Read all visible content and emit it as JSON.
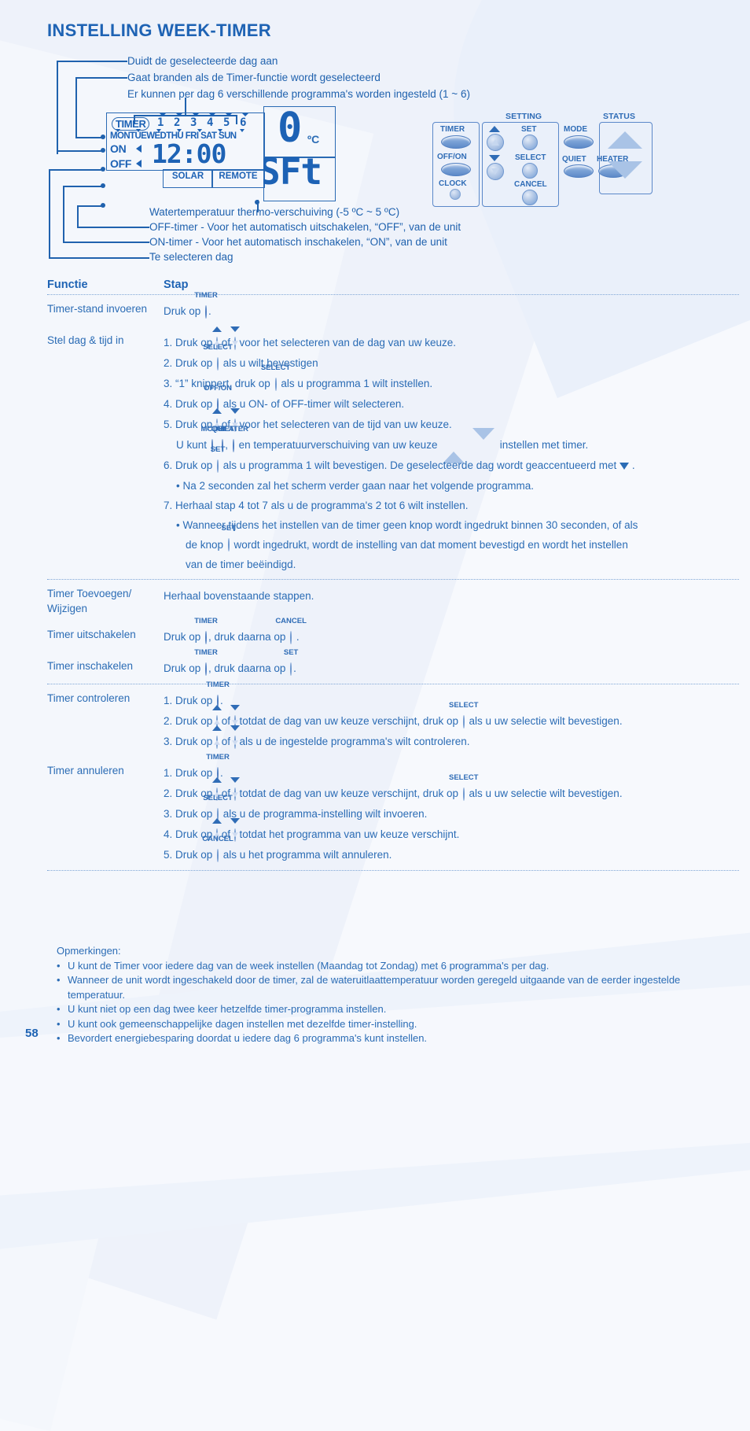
{
  "title": "INSTELLING WEEK-TIMER",
  "page_number": "58",
  "callouts_top": [
    "Duidt de geselecteerde dag aan",
    "Gaat branden als de Timer-functie wordt geselecteerd",
    "Er kunnen per dag 6 verschillende programma's worden ingesteld (1 ~ 6)"
  ],
  "callouts_bottom": [
    "Watertemperatuur thermo-verschuiving (-5 ºC ~ 5 ºC)",
    "OFF-timer - Voor het automatisch uitschakelen, “OFF”, van de unit",
    "ON-timer - Voor het automatisch inschakelen, “ON”, van de unit",
    "Te selecteren dag"
  ],
  "lcd": {
    "timer_label": "TIMER",
    "program_numbers": [
      "1",
      "2",
      "3",
      "4",
      "5",
      "6"
    ],
    "days": [
      "MON",
      "TUE",
      "WED",
      "THU",
      "FRI",
      "SAT",
      "SUN"
    ],
    "on_label": "ON",
    "off_label": "OFF",
    "clock_value": "12:00",
    "solar_label": "SOLAR",
    "remote_label": "REMOTE",
    "temp_value": "0",
    "temp_unit": "ºC",
    "shift_value": "SFt"
  },
  "panel": {
    "setting_group_label": "SETTING",
    "status_group_label": "STATUS",
    "buttons": {
      "timer": "TIMER",
      "off_on": "OFF/ON",
      "clock": "CLOCK",
      "set": "SET",
      "select": "SELECT",
      "cancel": "CANCEL",
      "mode": "MODE",
      "quiet": "QUIET",
      "heater": "HEATER"
    }
  },
  "table": {
    "header": {
      "col1": "Functie",
      "col2": "Stap"
    },
    "rows": [
      {
        "function": "Timer-stand invoeren",
        "lines": [
          {
            "indent": 0,
            "parts": [
              {
                "t": "text",
                "v": "Druk op "
              },
              {
                "t": "btn",
                "style": "oval",
                "cap": "TIMER"
              },
              {
                "t": "text",
                "v": "."
              }
            ]
          }
        ]
      },
      {
        "function": "Stel dag & tijd in",
        "lines": [
          {
            "indent": 0,
            "parts": [
              {
                "t": "text",
                "v": "1. Druk op "
              },
              {
                "t": "btn",
                "style": "up",
                "cap": ""
              },
              {
                "t": "text",
                "v": " of "
              },
              {
                "t": "btn",
                "style": "dn",
                "cap": ""
              },
              {
                "t": "text",
                "v": " voor het selecteren van de dag van uw keuze."
              }
            ]
          },
          {
            "indent": 0,
            "parts": [
              {
                "t": "text",
                "v": "2. Druk op "
              },
              {
                "t": "btn",
                "style": "round",
                "cap": "SELECT"
              },
              {
                "t": "text",
                "v": "  als u wilt bevestigen"
              }
            ]
          },
          {
            "indent": 0,
            "parts": [
              {
                "t": "text",
                "v": "3. “1” knippert, druk op "
              },
              {
                "t": "btn",
                "style": "round",
                "cap": "SELECT"
              },
              {
                "t": "text",
                "v": "  als u programma 1 wilt instellen."
              }
            ]
          },
          {
            "indent": 0,
            "parts": [
              {
                "t": "text",
                "v": "4. Druk op "
              },
              {
                "t": "btn",
                "style": "oval",
                "cap": "OFF/ON"
              },
              {
                "t": "text",
                "v": " als u ON- of OFF-timer wilt selecteren."
              }
            ]
          },
          {
            "indent": 0,
            "parts": [
              {
                "t": "text",
                "v": "5. Druk op "
              },
              {
                "t": "btn",
                "style": "up",
                "cap": ""
              },
              {
                "t": "text",
                "v": " of "
              },
              {
                "t": "btn",
                "style": "dn",
                "cap": ""
              },
              {
                "t": "text",
                "v": " voor het selecteren van de tijd van uw keuze."
              }
            ]
          },
          {
            "indent": 1,
            "parts": [
              {
                "t": "text",
                "v": "U kunt "
              },
              {
                "t": "btn",
                "style": "oval",
                "cap": "MODE"
              },
              {
                "t": "text",
                "v": ", "
              },
              {
                "t": "btn",
                "style": "oval",
                "cap": "QUIET"
              },
              {
                "t": "text",
                "v": ", "
              },
              {
                "t": "btn",
                "style": "oval",
                "cap": "HEATER"
              },
              {
                "t": "text",
                "v": " en temperatuurverschuiving van uw keuze "
              },
              {
                "t": "btn",
                "style": "bigup",
                "cap": ""
              },
              {
                "t": "text",
                "v": " "
              },
              {
                "t": "btn",
                "style": "bigdn",
                "cap": ""
              },
              {
                "t": "text",
                "v": " instellen met timer."
              }
            ]
          },
          {
            "indent": 0,
            "parts": [
              {
                "t": "text",
                "v": "6. Druk op "
              },
              {
                "t": "btn",
                "style": "round",
                "cap": "SET"
              },
              {
                "t": "text",
                "v": " als u programma 1 wilt bevestigen. De geselecteerde dag wordt geaccentueerd met "
              },
              {
                "t": "tri",
                "v": ""
              },
              {
                "t": "text",
                "v": " ."
              }
            ]
          },
          {
            "indent": 1,
            "parts": [
              {
                "t": "text",
                "v": "• Na 2 seconden zal het scherm verder gaan naar het volgende programma."
              }
            ]
          },
          {
            "indent": 0,
            "parts": [
              {
                "t": "text",
                "v": "7. Herhaal stap 4 tot 7 als u de programma's 2 tot 6 wilt instellen."
              }
            ]
          },
          {
            "indent": 1,
            "parts": [
              {
                "t": "text",
                "v": "• Wanneer tijdens het instellen van de timer geen knop wordt ingedrukt binnen 30 seconden, of als"
              }
            ]
          },
          {
            "indent": 2,
            "parts": [
              {
                "t": "text",
                "v": "de knop "
              },
              {
                "t": "btn",
                "style": "round",
                "cap": "SET"
              },
              {
                "t": "text",
                "v": " wordt ingedrukt, wordt de instelling van dat moment bevestigd en wordt het instellen"
              }
            ]
          },
          {
            "indent": 2,
            "parts": [
              {
                "t": "text",
                "v": "van de timer beëindigd."
              }
            ]
          }
        ]
      },
      {
        "function": "Timer Toevoegen/\nWijzigen",
        "lines": [
          {
            "indent": 0,
            "parts": [
              {
                "t": "text",
                "v": "Herhaal bovenstaande stappen."
              }
            ]
          }
        ]
      },
      {
        "function": "Timer uitschakelen",
        "lines": [
          {
            "indent": 0,
            "parts": [
              {
                "t": "text",
                "v": "Druk op "
              },
              {
                "t": "btn",
                "style": "oval",
                "cap": "TIMER"
              },
              {
                "t": "text",
                "v": ", druk daarna op "
              },
              {
                "t": "btn",
                "style": "round",
                "cap": "CANCEL"
              },
              {
                "t": "text",
                "v": " ."
              }
            ]
          }
        ]
      },
      {
        "function": "Timer inschakelen",
        "lines": [
          {
            "indent": 0,
            "parts": [
              {
                "t": "text",
                "v": "Druk op "
              },
              {
                "t": "btn",
                "style": "oval",
                "cap": "TIMER"
              },
              {
                "t": "text",
                "v": ", druk daarna op "
              },
              {
                "t": "btn",
                "style": "round",
                "cap": "SET"
              },
              {
                "t": "text",
                "v": "."
              }
            ]
          }
        ]
      },
      {
        "function": "Timer controleren",
        "lines": [
          {
            "indent": 0,
            "parts": [
              {
                "t": "text",
                "v": "1. Druk op "
              },
              {
                "t": "btn",
                "style": "oval",
                "cap": "TIMER"
              },
              {
                "t": "text",
                "v": "."
              }
            ]
          },
          {
            "indent": 0,
            "parts": [
              {
                "t": "text",
                "v": "2. Druk op "
              },
              {
                "t": "btn",
                "style": "up",
                "cap": ""
              },
              {
                "t": "text",
                "v": " of "
              },
              {
                "t": "btn",
                "style": "dn",
                "cap": ""
              },
              {
                "t": "text",
                "v": " totdat de dag van uw keuze verschijnt, druk op "
              },
              {
                "t": "btn",
                "style": "round",
                "cap": "SELECT"
              },
              {
                "t": "text",
                "v": "  als u uw selectie wilt bevestigen."
              }
            ]
          },
          {
            "indent": 0,
            "parts": [
              {
                "t": "text",
                "v": "3. Druk op "
              },
              {
                "t": "btn",
                "style": "up",
                "cap": ""
              },
              {
                "t": "text",
                "v": " of "
              },
              {
                "t": "btn",
                "style": "dn",
                "cap": ""
              },
              {
                "t": "text",
                "v": " als u de ingestelde programma's wilt controleren."
              }
            ]
          }
        ]
      },
      {
        "function": "Timer annuleren",
        "lines": [
          {
            "indent": 0,
            "parts": [
              {
                "t": "text",
                "v": "1. Druk op "
              },
              {
                "t": "btn",
                "style": "oval",
                "cap": "TIMER"
              },
              {
                "t": "text",
                "v": "."
              }
            ]
          },
          {
            "indent": 0,
            "parts": [
              {
                "t": "text",
                "v": "2. Druk op "
              },
              {
                "t": "btn",
                "style": "up",
                "cap": ""
              },
              {
                "t": "text",
                "v": " of "
              },
              {
                "t": "btn",
                "style": "dn",
                "cap": ""
              },
              {
                "t": "text",
                "v": " totdat de dag van uw keuze verschijnt, druk op "
              },
              {
                "t": "btn",
                "style": "round",
                "cap": "SELECT"
              },
              {
                "t": "text",
                "v": "  als u uw selectie wilt bevestigen."
              }
            ]
          },
          {
            "indent": 0,
            "parts": [
              {
                "t": "text",
                "v": "3. Druk op "
              },
              {
                "t": "btn",
                "style": "round",
                "cap": "SELECT"
              },
              {
                "t": "text",
                "v": "  als u de programma-instelling wilt invoeren."
              }
            ]
          },
          {
            "indent": 0,
            "parts": [
              {
                "t": "text",
                "v": "4. Druk op "
              },
              {
                "t": "btn",
                "style": "up",
                "cap": ""
              },
              {
                "t": "text",
                "v": " of "
              },
              {
                "t": "btn",
                "style": "dn",
                "cap": ""
              },
              {
                "t": "text",
                "v": " totdat het programma van uw keuze verschijnt."
              }
            ]
          },
          {
            "indent": 0,
            "parts": [
              {
                "t": "text",
                "v": "5. Druk op "
              },
              {
                "t": "btn",
                "style": "round",
                "cap": "CANCEL"
              },
              {
                "t": "text",
                "v": "  als u het programma wilt annuleren."
              }
            ]
          }
        ]
      }
    ]
  },
  "remarks": {
    "title": "Opmerkingen:",
    "items": [
      "U kunt de Timer voor iedere dag van de week instellen (Maandag tot Zondag) met 6 programma's per dag.",
      "Wanneer de unit wordt ingeschakeld door de timer, zal de wateruitlaattemperatuur worden geregeld uitgaande van de eerder ingestelde temperatuur.",
      "U kunt niet op een dag twee keer hetzelfde timer-programma instellen.",
      "U kunt ook gemeenschappelijke dagen instellen met dezelfde timer-instelling.",
      "Bevordert energiebesparing doordat u iedere dag 6 programma's kunt instellen."
    ]
  },
  "colors": {
    "accent": "#1e63b4",
    "text": "#2b6cb5",
    "lcd": "#1d62b5",
    "button_face": "#7ba2d6",
    "background": "#f7f9fd"
  }
}
